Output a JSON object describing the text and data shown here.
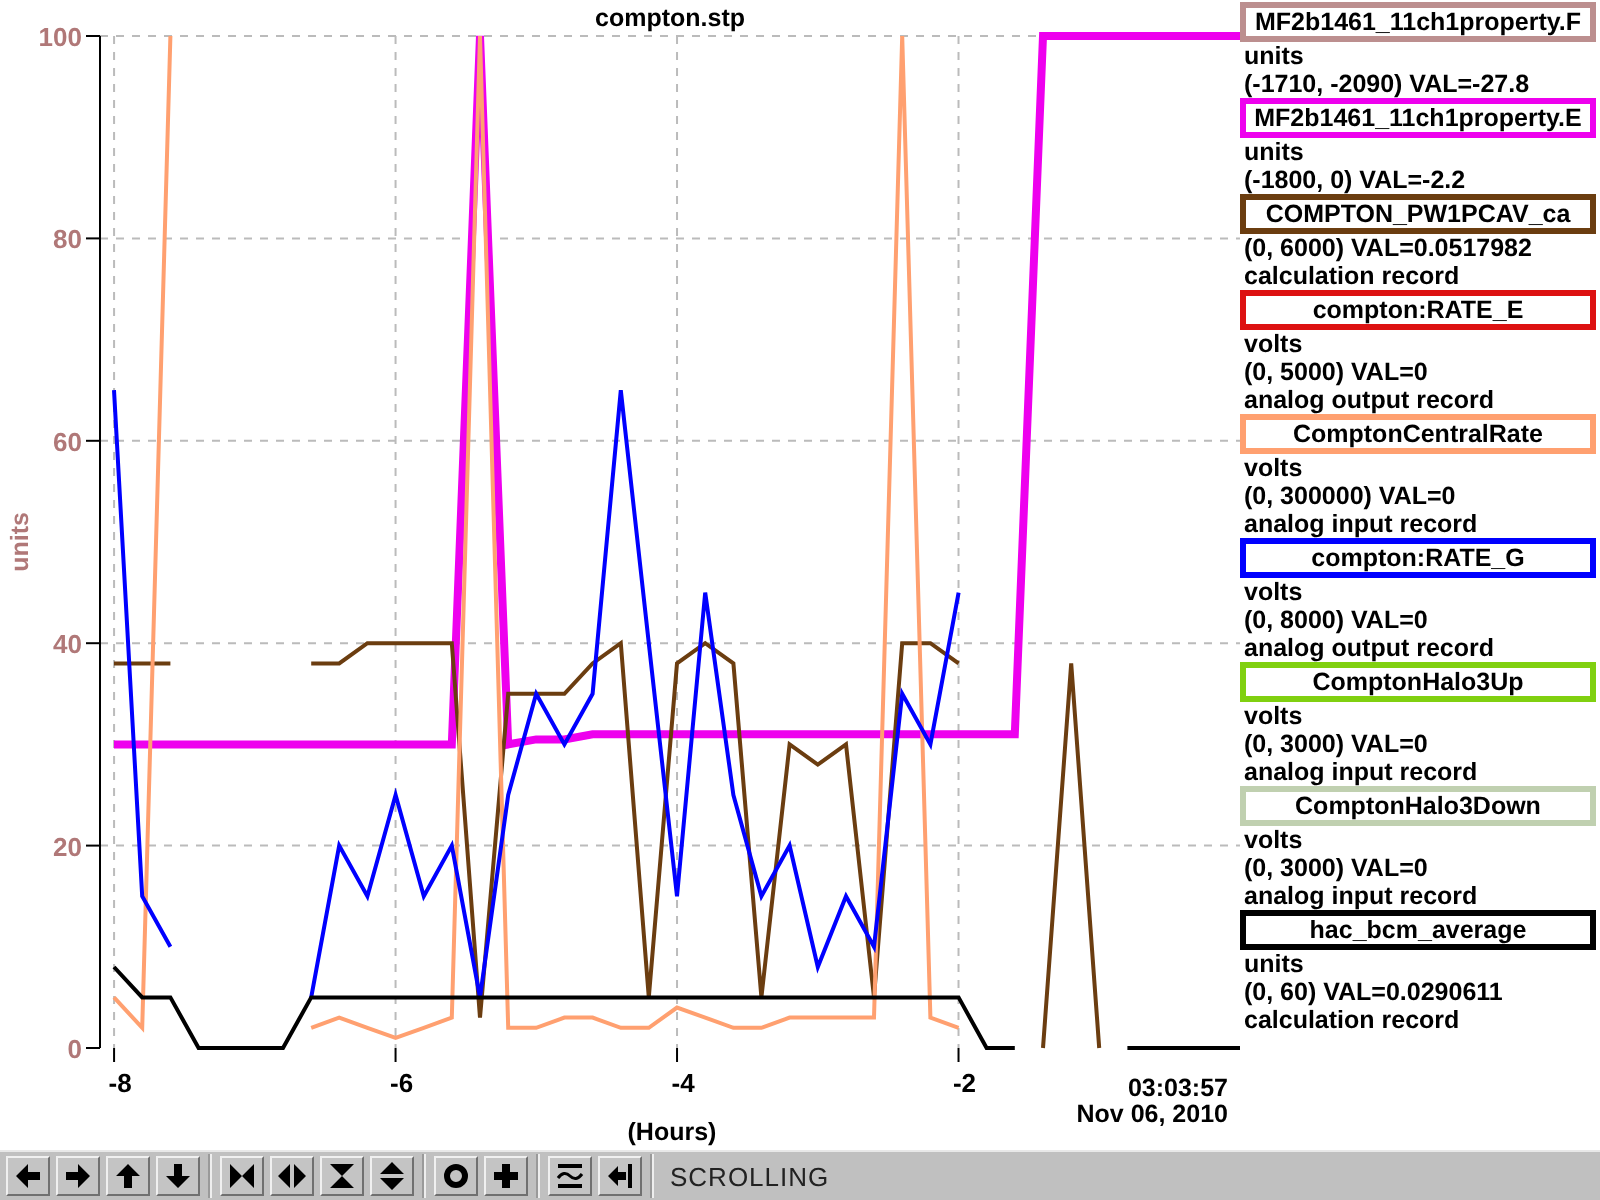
{
  "plot": {
    "title": "compton.stp",
    "time_label": "03:03:57",
    "date_label": "Nov 06, 2010",
    "chart_data": {
      "type": "line",
      "grid": true,
      "xlabel": "(Hours)",
      "ylabel": "units",
      "xlim": [
        -8.1,
        0
      ],
      "ylim": [
        0,
        100
      ],
      "xticks": [
        -8,
        -6,
        -4,
        -2
      ],
      "yticks": [
        0,
        20,
        40,
        60,
        80,
        100
      ],
      "x": [
        -8.0,
        -7.8,
        -7.6,
        -7.4,
        -7.2,
        -7.0,
        -6.8,
        -6.6,
        -6.4,
        -6.2,
        -6.0,
        -5.8,
        -5.6,
        -5.4,
        -5.2,
        -5.0,
        -4.8,
        -4.6,
        -4.4,
        -4.2,
        -4.0,
        -3.8,
        -3.6,
        -3.4,
        -3.2,
        -3.0,
        -2.8,
        -2.6,
        -2.4,
        -2.2,
        -2.0,
        -1.8,
        -1.6,
        -1.4,
        -1.2,
        -1.0,
        -0.8,
        -0.6,
        -0.4,
        -0.2,
        0.0
      ],
      "series": [
        {
          "name": "MF2b1461_11ch1property.E",
          "color": "#ee00ee",
          "values": [
            30,
            30,
            30,
            30,
            30,
            30,
            30,
            30,
            30,
            30,
            30,
            30,
            30,
            100,
            30,
            30.5,
            30.5,
            31,
            31,
            31,
            31,
            31,
            31,
            31,
            31,
            31,
            31,
            31,
            31,
            31,
            31,
            31,
            31,
            100,
            100,
            100,
            100,
            100,
            100,
            100,
            100
          ]
        },
        {
          "name": "COMPTON_PW1PCAV_ca",
          "color": "#6b3d10",
          "values": [
            38,
            38,
            38,
            null,
            null,
            null,
            null,
            38,
            38,
            40,
            40,
            40,
            40,
            3,
            35,
            35,
            35,
            38,
            40,
            5,
            38,
            40,
            38,
            5,
            30,
            28,
            30,
            5,
            40,
            40,
            38,
            null,
            null,
            0,
            38,
            0,
            null,
            null,
            null,
            null,
            null
          ]
        },
        {
          "name": "ComptonCentralRate",
          "color": "#ffa070",
          "values": [
            5,
            2,
            100,
            null,
            null,
            null,
            null,
            2,
            3,
            2,
            1,
            2,
            3,
            100,
            2,
            2,
            3,
            3,
            2,
            2,
            4,
            3,
            2,
            2,
            3,
            3,
            3,
            3,
            100,
            3,
            2,
            null,
            null,
            null,
            null,
            null,
            null,
            null,
            null,
            null,
            null
          ]
        },
        {
          "name": "compton:RATE_G",
          "color": "#0000ff",
          "values": [
            65,
            15,
            10,
            null,
            null,
            null,
            null,
            5,
            20,
            15,
            25,
            15,
            20,
            5,
            25,
            35,
            30,
            35,
            65,
            40,
            15,
            45,
            25,
            15,
            20,
            8,
            15,
            10,
            35,
            30,
            45,
            null,
            null,
            null,
            null,
            null,
            null,
            null,
            null,
            null,
            null
          ]
        },
        {
          "name": "hac_bcm_average",
          "color": "#000000",
          "values": [
            8,
            5,
            5,
            0,
            0,
            0,
            0,
            5,
            5,
            5,
            5,
            5,
            5,
            5,
            5,
            5,
            5,
            5,
            5,
            5,
            5,
            5,
            5,
            5,
            5,
            5,
            5,
            5,
            5,
            5,
            5,
            0,
            0,
            null,
            null,
            null,
            0,
            0,
            0,
            0,
            0
          ]
        }
      ]
    }
  },
  "legend": [
    {
      "kind": "channel",
      "name": "MF2b1461_11ch1property.F",
      "color": "#bc8f8f",
      "lines": [
        "units",
        "(-1710, -2090) VAL=-27.8"
      ]
    },
    {
      "kind": "series",
      "lines": [
        "units",
        "(-1800, 0) VAL=-2.2"
      ]
    },
    {
      "kind": "series",
      "lines": [
        "(0, 6000) VAL=0.0517982",
        "calculation record"
      ]
    },
    {
      "kind": "channel",
      "name": "compton:RATE_E",
      "color": "#dd1111",
      "lines": [
        "volts",
        "(0, 5000) VAL=0",
        "analog output record"
      ]
    },
    {
      "kind": "series",
      "lines": [
        "volts",
        "(0, 300000) VAL=0",
        "analog input record"
      ]
    },
    {
      "kind": "series",
      "lines": [
        "volts",
        "(0, 8000) VAL=0",
        "analog output record"
      ]
    },
    {
      "kind": "channel",
      "name": "ComptonHalo3Up",
      "color": "#80d010",
      "lines": [
        "volts",
        "(0, 3000) VAL=0",
        "analog input record"
      ]
    },
    {
      "kind": "channel",
      "name": "ComptonHalo3Down",
      "color": "#c0d0b0",
      "lines": [
        "volts",
        "(0, 3000) VAL=0",
        "analog input record"
      ]
    },
    {
      "kind": "series",
      "lines": [
        "units",
        "(0, 60) VAL=0.0290611",
        "calculation record"
      ]
    }
  ],
  "toolbar": {
    "status": "SCROLLING"
  }
}
